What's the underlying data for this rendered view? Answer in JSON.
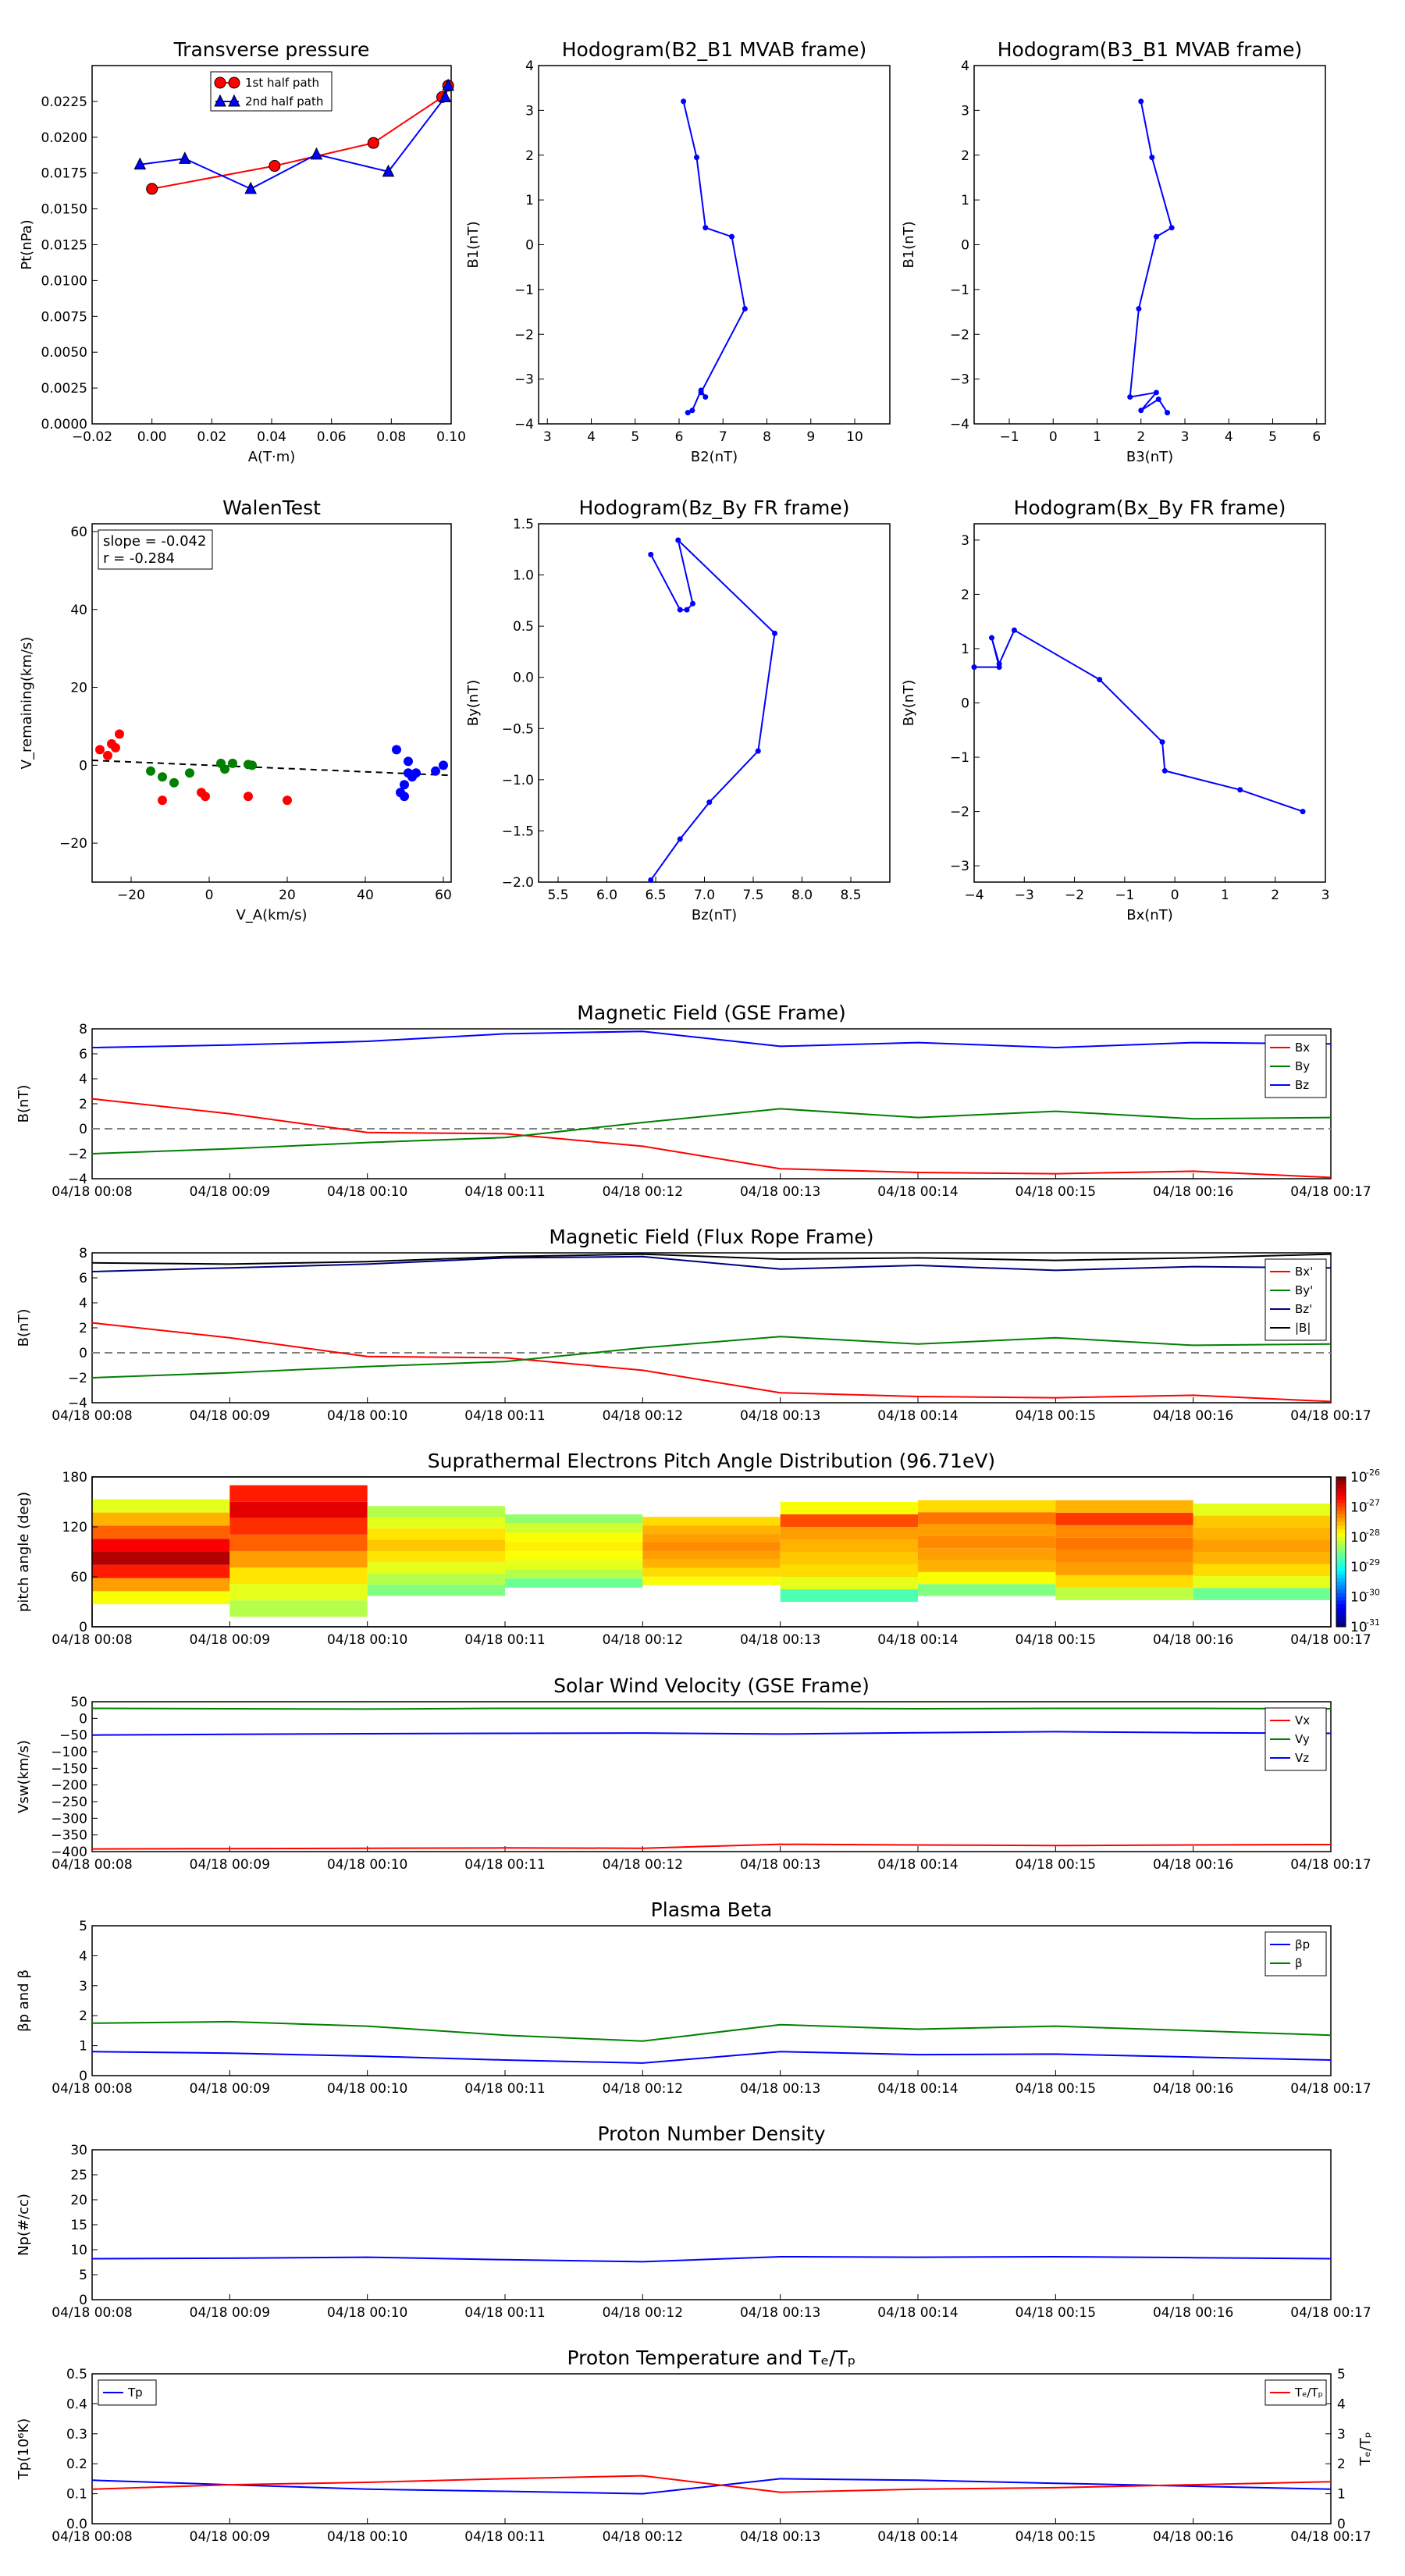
{
  "colors": {
    "red": "#ff0000",
    "green": "#008000",
    "blue": "#0000ff",
    "navy": "#000080",
    "black": "#000000",
    "grey": "#808080"
  },
  "time_ticks": [
    "04/18 00:08",
    "04/18 00:09",
    "04/18 00:10",
    "04/18 00:11",
    "04/18 00:12",
    "04/18 00:13",
    "04/18 00:14",
    "04/18 00:15",
    "04/18 00:16",
    "04/18 00:17"
  ],
  "chart_data": [
    {
      "id": "tp",
      "type": "line",
      "title": "Transverse pressure",
      "xlabel": "A(T·m)",
      "ylabel": "Pt(nPa)",
      "xlim": [
        -0.02,
        0.1
      ],
      "ylim": [
        0,
        0.025
      ],
      "xticks": [
        "−0.02",
        "0.00",
        "0.02",
        "0.04",
        "0.06",
        "0.08",
        "0.10"
      ],
      "yticks": [
        "0.0000",
        "0.0025",
        "0.0050",
        "0.0075",
        "0.0100",
        "0.0125",
        "0.0150",
        "0.0175",
        "0.0200",
        "0.0225"
      ],
      "series": [
        {
          "name": "1st half path",
          "color": "red",
          "marker": "circle",
          "x": [
            0.0,
            0.041,
            0.074,
            0.097,
            0.099
          ],
          "y": [
            0.0164,
            0.018,
            0.0196,
            0.0228,
            0.0236
          ]
        },
        {
          "name": "2nd half path",
          "color": "blue",
          "marker": "triangle",
          "x": [
            -0.004,
            0.011,
            0.033,
            0.055,
            0.079,
            0.098,
            0.099
          ],
          "y": [
            0.0181,
            0.0185,
            0.0164,
            0.0188,
            0.0176,
            0.0228,
            0.0236
          ]
        }
      ],
      "legend": "top-center"
    },
    {
      "id": "h21",
      "type": "line",
      "title": "Hodogram(B2_B1 MVAB frame)",
      "xlabel": "B2(nT)",
      "ylabel": "B1(nT)",
      "xlim": [
        2.8,
        10.8
      ],
      "ylim": [
        -4,
        4
      ],
      "xticks": [
        "3",
        "4",
        "5",
        "6",
        "7",
        "8",
        "9",
        "10"
      ],
      "yticks": [
        "−4",
        "−3",
        "−2",
        "−1",
        "0",
        "1",
        "2",
        "3",
        "4"
      ],
      "series": [
        {
          "color": "blue",
          "marker": "dot",
          "x": [
            6.1,
            6.4,
            6.6,
            7.2,
            7.5,
            6.5,
            6.6,
            6.5,
            6.3,
            6.2
          ],
          "y": [
            3.2,
            1.95,
            0.38,
            0.18,
            -1.43,
            -3.3,
            -3.4,
            -3.25,
            -3.7,
            -3.75
          ]
        }
      ]
    },
    {
      "id": "h31",
      "type": "line",
      "title": "Hodogram(B3_B1 MVAB frame)",
      "xlabel": "B3(nT)",
      "ylabel": "B1(nT)",
      "xlim": [
        -1.8,
        6.2
      ],
      "ylim": [
        -4,
        4
      ],
      "xticks": [
        "−1",
        "0",
        "1",
        "2",
        "3",
        "4",
        "5",
        "6"
      ],
      "yticks": [
        "−4",
        "−3",
        "−2",
        "−1",
        "0",
        "1",
        "2",
        "3",
        "4"
      ],
      "series": [
        {
          "color": "blue",
          "marker": "dot",
          "x": [
            2.0,
            2.25,
            2.7,
            2.35,
            1.95,
            1.75,
            2.35,
            2.0,
            2.4,
            2.6
          ],
          "y": [
            3.2,
            1.95,
            0.38,
            0.18,
            -1.43,
            -3.4,
            -3.3,
            -3.7,
            -3.45,
            -3.75
          ]
        }
      ]
    },
    {
      "id": "walen",
      "type": "scatter",
      "title": "WalenTest",
      "xlabel": "V_A(km/s)",
      "ylabel": "V_remaining(km/s)",
      "xlim": [
        -30,
        62
      ],
      "ylim": [
        -30,
        62
      ],
      "xticks": [
        "−20",
        "0",
        "20",
        "40",
        "60"
      ],
      "yticks": [
        "−20",
        "0",
        "20",
        "40",
        "60"
      ],
      "annotation": [
        "slope = -0.042",
        "r = -0.284"
      ],
      "fit": {
        "slope": -0.042,
        "intercept": 0
      },
      "series": [
        {
          "color": "red",
          "x": [
            -28,
            -26,
            -25,
            -24,
            -23,
            -12,
            -2,
            -1,
            10,
            20
          ],
          "y": [
            4,
            2.5,
            5.5,
            4.5,
            8,
            -9,
            -7,
            -8,
            -8,
            -9
          ]
        },
        {
          "color": "green",
          "x": [
            -15,
            -12,
            -9,
            -5,
            3,
            4,
            6,
            10,
            11
          ],
          "y": [
            -1.5,
            -3,
            -4.5,
            -2,
            0.5,
            -1,
            0.5,
            0.2,
            0
          ]
        },
        {
          "color": "blue",
          "x": [
            48,
            49,
            50,
            50,
            51,
            51,
            52,
            53,
            58,
            60
          ],
          "y": [
            4,
            -7,
            -8,
            -5,
            1,
            -2,
            -3,
            -2,
            -1.5,
            0
          ]
        }
      ]
    },
    {
      "id": "hbzby",
      "type": "line",
      "title": "Hodogram(Bz_By FR frame)",
      "xlabel": "Bz(nT)",
      "ylabel": "By(nT)",
      "xlim": [
        5.3,
        8.9
      ],
      "ylim": [
        -2.0,
        1.5
      ],
      "xticks": [
        "5.5",
        "6.0",
        "6.5",
        "7.0",
        "7.5",
        "8.0",
        "8.5"
      ],
      "yticks": [
        "−2.0",
        "−1.5",
        "−1.0",
        "−0.5",
        "0.0",
        "0.5",
        "1.0",
        "1.5"
      ],
      "series": [
        {
          "color": "blue",
          "marker": "dot",
          "x": [
            6.45,
            6.75,
            7.05,
            7.55,
            7.72,
            6.73,
            6.88,
            6.82,
            6.75,
            6.45
          ],
          "y": [
            -1.98,
            -1.58,
            -1.22,
            -0.72,
            0.43,
            1.34,
            0.72,
            0.66,
            0.66,
            1.2
          ]
        }
      ]
    },
    {
      "id": "hbxby",
      "type": "line",
      "title": "Hodogram(Bx_By FR frame)",
      "xlabel": "Bx(nT)",
      "ylabel": "By(nT)",
      "xlim": [
        -4,
        3
      ],
      "ylim": [
        -3.3,
        3.3
      ],
      "xticks": [
        "−4",
        "−3",
        "−2",
        "−1",
        "0",
        "1",
        "2",
        "3"
      ],
      "yticks": [
        "−3",
        "−2",
        "−1",
        "0",
        "1",
        "2",
        "3"
      ],
      "series": [
        {
          "color": "blue",
          "marker": "dot",
          "x": [
            2.55,
            1.3,
            -0.2,
            -0.25,
            -1.5,
            -3.2,
            -3.5,
            -3.65,
            -3.5,
            -4.0
          ],
          "y": [
            -2.0,
            -1.6,
            -1.25,
            -0.72,
            0.43,
            1.34,
            0.72,
            1.2,
            0.66,
            0.66
          ]
        }
      ]
    },
    {
      "id": "mag_gse",
      "type": "line",
      "title": "Magnetic Field (GSE Frame)",
      "ylabel": "B(nT)",
      "ylim": [
        -4,
        8
      ],
      "yticks": [
        "−4",
        "−2",
        "0",
        "2",
        "4",
        "6",
        "8"
      ],
      "zero_line": true,
      "legend": "top-right",
      "x": [
        0,
        1,
        2,
        3,
        4,
        5,
        6,
        7,
        8,
        9
      ],
      "series": [
        {
          "name": "Bx",
          "color": "red",
          "values": [
            2.4,
            1.2,
            -0.3,
            -0.4,
            -1.4,
            -3.2,
            -3.5,
            -3.6,
            -3.4,
            -3.9
          ]
        },
        {
          "name": "By",
          "color": "green",
          "values": [
            -2.0,
            -1.6,
            -1.1,
            -0.7,
            0.5,
            1.6,
            0.9,
            1.4,
            0.8,
            0.9
          ]
        },
        {
          "name": "Bz",
          "color": "blue",
          "values": [
            6.5,
            6.7,
            7.0,
            7.6,
            7.8,
            6.6,
            6.9,
            6.5,
            6.9,
            6.8
          ]
        }
      ]
    },
    {
      "id": "mag_fr",
      "type": "line",
      "title": "Magnetic Field (Flux Rope Frame)",
      "ylabel": "B(nT)",
      "ylim": [
        -4,
        8
      ],
      "yticks": [
        "−4",
        "−2",
        "0",
        "2",
        "4",
        "6",
        "8"
      ],
      "zero_line": true,
      "legend": "top-right",
      "x": [
        0,
        1,
        2,
        3,
        4,
        5,
        6,
        7,
        8,
        9
      ],
      "series": [
        {
          "name": "Bx'",
          "color": "red",
          "values": [
            2.4,
            1.2,
            -0.3,
            -0.4,
            -1.4,
            -3.2,
            -3.5,
            -3.6,
            -3.4,
            -3.9
          ]
        },
        {
          "name": "By'",
          "color": "green",
          "values": [
            -2.0,
            -1.6,
            -1.1,
            -0.7,
            0.4,
            1.3,
            0.7,
            1.2,
            0.6,
            0.7
          ]
        },
        {
          "name": "Bz'",
          "color": "navy",
          "values": [
            6.5,
            6.8,
            7.1,
            7.6,
            7.7,
            6.7,
            7.0,
            6.6,
            6.9,
            6.8
          ]
        },
        {
          "name": "|B|",
          "color": "black",
          "values": [
            7.2,
            7.1,
            7.3,
            7.7,
            7.9,
            7.5,
            7.6,
            7.4,
            7.6,
            7.9
          ]
        }
      ]
    },
    {
      "id": "pad",
      "type": "heatmap",
      "title": "Suprathermal Electrons Pitch Angle Distribution (96.71eV)",
      "ylabel": "pitch angle (deg)",
      "ylim": [
        0,
        180
      ],
      "yticks": [
        "0",
        "60",
        "120",
        "180"
      ],
      "colorbar_ticks": [
        "-26",
        "-27",
        "-28",
        "-29",
        "-30",
        "-31"
      ],
      "columns": [
        {
          "x0": 0,
          "x1": 1,
          "top": 153,
          "bottom": 27,
          "bands": [
            0.62,
            0.72,
            0.85,
            0.95,
            0.88,
            0.78,
            0.7,
            0.6
          ]
        },
        {
          "x0": 1,
          "x1": 2,
          "top": 170,
          "bottom": 12,
          "bands": [
            0.55,
            0.6,
            0.65,
            0.72,
            0.78,
            0.83,
            0.9,
            0.85
          ]
        },
        {
          "x0": 2,
          "x1": 3,
          "top": 145,
          "bottom": 37,
          "bands": [
            0.5,
            0.55,
            0.6,
            0.65,
            0.68,
            0.65,
            0.6,
            0.55
          ]
        },
        {
          "x0": 3,
          "x1": 4,
          "top": 135,
          "bottom": 47,
          "bands": [
            0.48,
            0.55,
            0.6,
            0.62,
            0.64,
            0.62,
            0.58,
            0.52
          ]
        },
        {
          "x0": 4,
          "x1": 5,
          "top": 132,
          "bottom": 50,
          "bands": [
            0.62,
            0.66,
            0.7,
            0.72,
            0.74,
            0.72,
            0.7,
            0.66
          ]
        },
        {
          "x0": 5,
          "x1": 6,
          "top": 150,
          "bottom": 30,
          "bands": [
            0.45,
            0.6,
            0.66,
            0.68,
            0.7,
            0.72,
            0.8,
            0.62
          ]
        },
        {
          "x0": 6,
          "x1": 7,
          "top": 152,
          "bottom": 37,
          "bands": [
            0.5,
            0.62,
            0.7,
            0.72,
            0.74,
            0.72,
            0.76,
            0.66
          ]
        },
        {
          "x0": 7,
          "x1": 8,
          "top": 152,
          "bottom": 32,
          "bands": [
            0.56,
            0.66,
            0.72,
            0.74,
            0.76,
            0.74,
            0.82,
            0.7
          ]
        },
        {
          "x0": 8,
          "x1": 9,
          "top": 148,
          "bottom": 32,
          "bands": [
            0.48,
            0.6,
            0.66,
            0.7,
            0.72,
            0.7,
            0.68,
            0.6
          ]
        }
      ]
    },
    {
      "id": "vsw",
      "type": "line",
      "title": "Solar Wind Velocity (GSE Frame)",
      "ylabel": "Vsw(km/s)",
      "ylim": [
        -400,
        50
      ],
      "yticks": [
        "−400",
        "−350",
        "−300",
        "−250",
        "−200",
        "−150",
        "−100",
        "−50",
        "0",
        "50"
      ],
      "legend": "top-right",
      "x": [
        0,
        1,
        2,
        3,
        4,
        5,
        6,
        7,
        8,
        9
      ],
      "series": [
        {
          "name": "Vx",
          "color": "red",
          "values": [
            -392,
            -391,
            -390,
            -389,
            -390,
            -378,
            -380,
            -382,
            -380,
            -379
          ]
        },
        {
          "name": "Vy",
          "color": "green",
          "values": [
            30,
            29,
            28,
            30,
            30,
            30,
            29,
            30,
            30,
            29
          ]
        },
        {
          "name": "Vz",
          "color": "blue",
          "values": [
            -50,
            -48,
            -46,
            -45,
            -44,
            -47,
            -43,
            -40,
            -43,
            -45
          ]
        }
      ]
    },
    {
      "id": "beta",
      "type": "line",
      "title": "Plasma Beta",
      "ylabel": "βp and β",
      "ylim": [
        0,
        5
      ],
      "yticks": [
        "0",
        "1",
        "2",
        "3",
        "4",
        "5"
      ],
      "legend": "top-right",
      "x": [
        0,
        1,
        2,
        3,
        4,
        5,
        6,
        7,
        8,
        9
      ],
      "series": [
        {
          "name": "βp",
          "color": "blue",
          "values": [
            0.8,
            0.75,
            0.65,
            0.52,
            0.42,
            0.8,
            0.7,
            0.72,
            0.62,
            0.52
          ]
        },
        {
          "name": "β",
          "color": "green",
          "values": [
            1.75,
            1.8,
            1.65,
            1.35,
            1.15,
            1.7,
            1.55,
            1.65,
            1.5,
            1.35
          ]
        }
      ]
    },
    {
      "id": "np",
      "type": "line",
      "title": "Proton Number Density",
      "ylabel": "Np(#/cc)",
      "ylim": [
        0,
        30
      ],
      "yticks": [
        "0",
        "5",
        "10",
        "15",
        "20",
        "25",
        "30"
      ],
      "x": [
        0,
        1,
        2,
        3,
        4,
        5,
        6,
        7,
        8,
        9
      ],
      "series": [
        {
          "color": "blue",
          "values": [
            8.2,
            8.3,
            8.5,
            8.0,
            7.6,
            8.6,
            8.5,
            8.6,
            8.4,
            8.2
          ]
        }
      ]
    },
    {
      "id": "temp",
      "type": "line",
      "title": "Proton Temperature and Tₑ/Tₚ",
      "ylabel": "Tp(10⁶K)",
      "ylim": [
        0,
        0.5
      ],
      "yticks": [
        "0.0",
        "0.1",
        "0.2",
        "0.3",
        "0.4",
        "0.5"
      ],
      "y2label": "Tₑ/Tₚ",
      "y2lim": [
        0,
        5
      ],
      "y2ticks": [
        "0",
        "1",
        "2",
        "3",
        "4",
        "5"
      ],
      "x": [
        0,
        1,
        2,
        3,
        4,
        5,
        6,
        7,
        8,
        9
      ],
      "series": [
        {
          "name": "Tp",
          "color": "blue",
          "axis": "left",
          "values": [
            0.145,
            0.13,
            0.115,
            0.108,
            0.1,
            0.15,
            0.145,
            0.135,
            0.125,
            0.115
          ]
        },
        {
          "name": "Tₑ/Tₚ",
          "color": "red",
          "axis": "right",
          "values": [
            1.15,
            1.3,
            1.38,
            1.5,
            1.6,
            1.05,
            1.15,
            1.2,
            1.3,
            1.4
          ]
        }
      ]
    }
  ]
}
